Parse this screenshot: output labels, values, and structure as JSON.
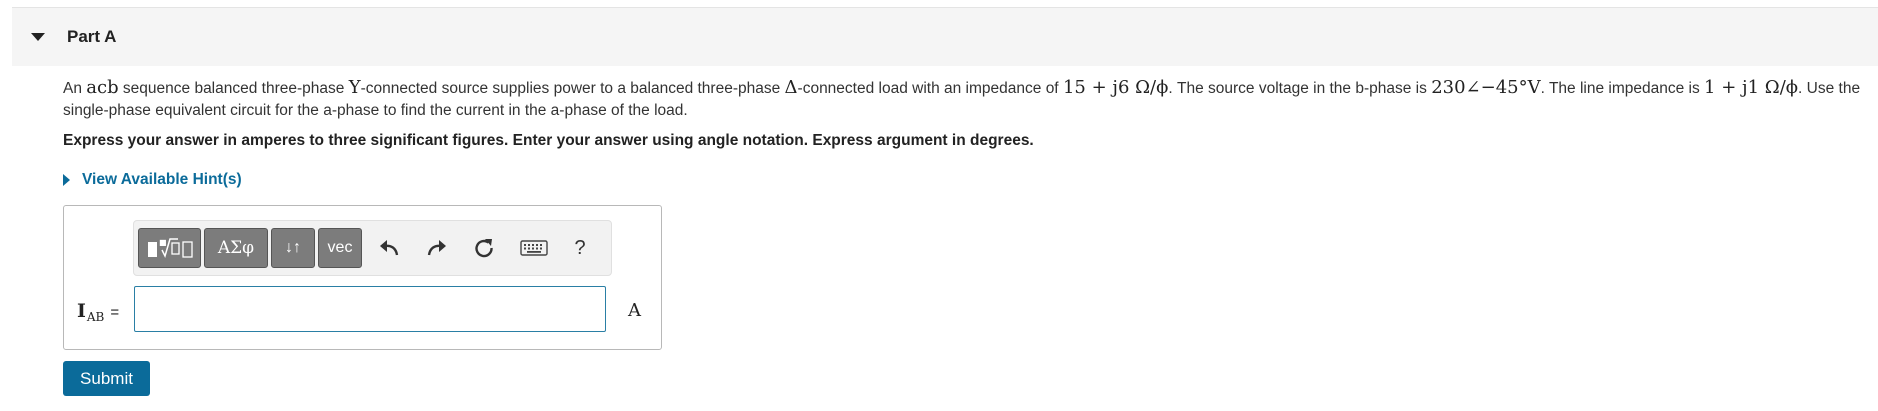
{
  "part": {
    "title": "Part A"
  },
  "problem": {
    "t1": "An ",
    "m1": "acb",
    "t2": " sequence balanced three-phase ",
    "m2": "Y",
    "t3": "-connected source supplies power to a balanced three-phase ",
    "m3": "Δ",
    "t4": "-connected load with an impedance of ",
    "m4": "15 + j6 Ω/ϕ",
    "t5": ". The source voltage in the b-phase is ",
    "m5": "230∠−45°V",
    "t6": ". The line impedance is ",
    "m6": "1 + j1 Ω/ϕ",
    "t7": ". Use the single-phase equivalent circuit for the a-phase to find the current in the a-phase of the load."
  },
  "instructions": "Express your answer in amperes to three significant figures. Enter your answer using angle notation. Express argument in degrees.",
  "hint": {
    "label": "View Available Hint(s)"
  },
  "toolbar": {
    "templates_icon": "templates-icon",
    "greek_label": "ΑΣφ",
    "arrows_label": "↓↑",
    "vec_label": "vec",
    "undo_icon": "undo-icon",
    "redo_icon": "redo-icon",
    "reset_icon": "reset-icon",
    "keyboard_icon": "keyboard-icon",
    "help_label": "?"
  },
  "answer": {
    "variable": "I",
    "subscript": "AB",
    "equals": "=",
    "value": "",
    "unit": "A"
  },
  "submit_label": "Submit",
  "colors": {
    "accent": "#0b6b9a",
    "header_bg": "#f5f5f5",
    "toolbar_button": "#7c7c7c"
  }
}
